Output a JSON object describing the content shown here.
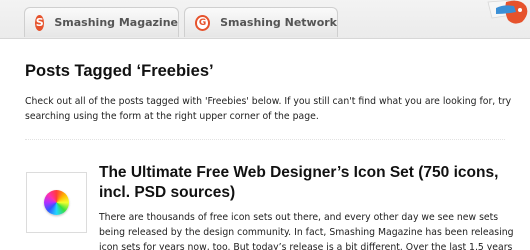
{
  "tabs": [
    {
      "label": "Smashing Magazine",
      "icon": "smashing-magazine-logo-icon",
      "icon_glyph": "S"
    },
    {
      "label": "Smashing Network",
      "icon": "smashing-network-logo-icon",
      "icon_glyph": "G"
    }
  ],
  "page": {
    "title": "Posts Tagged ‘Freebies’",
    "intro": "Check out all of the posts tagged with 'Freebies' below. If you still can't find what you are looking for, try searching using the form at the right upper corner of the page."
  },
  "post": {
    "title": "The Ultimate Free Web Designer’s Icon Set (750 icons, incl. PSD sources)",
    "thumbnail_icon": "color-wheel-icon",
    "excerpt_lines": [
      "There are thousands of free icon sets out there, and every other day we see new sets",
      "being released by the design community. In fact, Smashing Magazine has been releasing",
      "icon sets for years now, too. But today’s release is a bit different. Over the last 1.5 years"
    ]
  },
  "colors": {
    "accent": "#e6532d",
    "text": "#222222",
    "tab_bar": "#ebebeb"
  }
}
